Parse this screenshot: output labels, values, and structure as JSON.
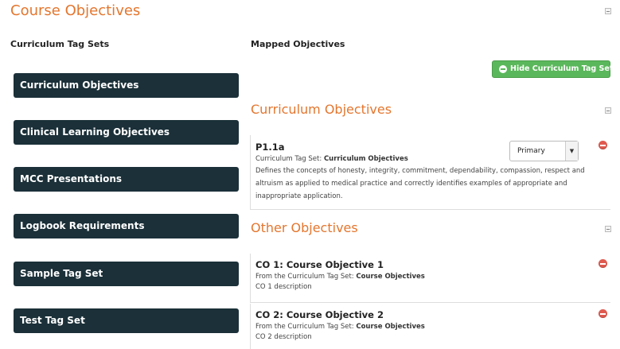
{
  "page": {
    "title": "Course Objectives"
  },
  "columns": {
    "left_heading": "Curriculum Tag Sets",
    "right_heading": "Mapped Objectives"
  },
  "tag_sets": [
    {
      "label": "Curriculum Objectives"
    },
    {
      "label": "Clinical Learning Objectives"
    },
    {
      "label": "MCC Presentations"
    },
    {
      "label": "Logbook Requirements"
    },
    {
      "label": "Sample Tag Set"
    },
    {
      "label": "Test Tag Set"
    }
  ],
  "hide_button": {
    "label": "Hide Curriculum Tag Sets",
    "color": "#5bb75b"
  },
  "sections": {
    "curriculum": {
      "title": "Curriculum Objectives",
      "objectives": [
        {
          "code": "P1.1a",
          "tag_set_prefix": "Curriculum Tag Set: ",
          "tag_set_name": "Curriculum Objectives",
          "description": "Defines the concepts of honesty, integrity, commitment, dependability, compassion, respect and altruism as applied to medical practice and correctly identifies examples of appropriate and inappropriate application.",
          "select_value": "Primary"
        }
      ]
    },
    "other": {
      "title": "Other Objectives",
      "objectives": [
        {
          "code": "CO 1: Course Objective 1",
          "tag_set_prefix": "From the Curriculum Tag Set: ",
          "tag_set_name": "Course Objectives",
          "description": "CO 1 description"
        },
        {
          "code": "CO 2: Course Objective 2",
          "tag_set_prefix": "From the Curriculum Tag Set: ",
          "tag_set_name": "Course Objectives",
          "description": "CO 2 description"
        }
      ]
    }
  },
  "colors": {
    "accent": "#e4762e",
    "tag_button": "#1b3039",
    "remove": "#e05a4f"
  },
  "icons": {
    "collapse": "collapse-icon",
    "remove": "remove-icon",
    "hide": "minus-circle-icon",
    "dropdown": "caret-down-icon"
  }
}
